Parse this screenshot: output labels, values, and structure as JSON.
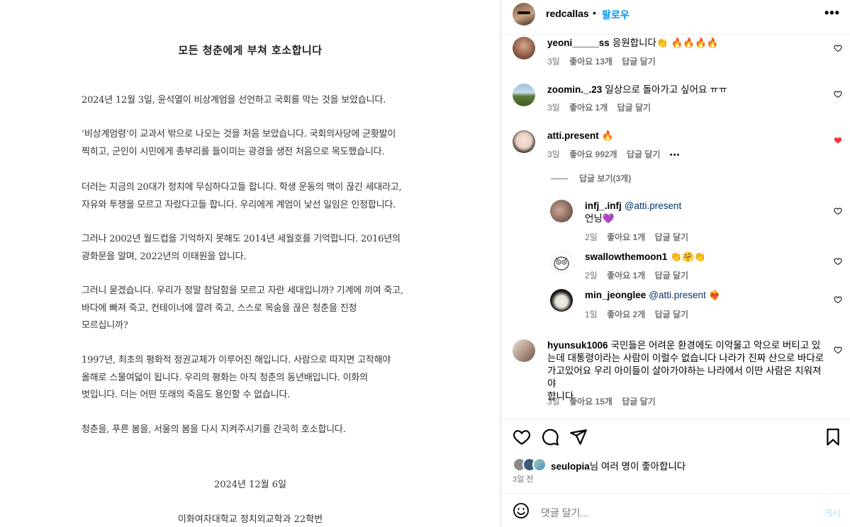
{
  "document": {
    "title": "모든 청춘에게 부쳐 호소합니다",
    "paragraphs": [
      [
        "2024년 12월 3일, 윤석열이 비상계엄을 선언하고 국회를 막는 것을 보았습니다."
      ],
      [
        "‘비상계엄령’이 교과서 밖으로 나오는 것을 처음 보았습니다. 국회의사당에 군홧발이",
        "찍히고, 군인이 시민에게 총부리를 들이미는 광경을 생전 처음으로 목도했습니다."
      ],
      [
        "더러는 지금의 20대가 정치에 무심하다고들 합니다. 학생 운동의 맥이 끊긴 세대라고,",
        "자유와 투쟁을 모르고 자랐다고들 합니다. 우리에게 계엄이 낯선 일임은 인정합니다."
      ],
      [
        "그러나 2002년 월드컵을 기억하지 못해도 2014년 세월호를 기억합니다. 2016년의",
        "광화문을 알며, 2022년의 이태원을 압니다."
      ],
      [
        "그러니 묻겠습니다. 우리가 정말 참담함을 모르고 자란 세대입니까? 기계에 끼여 죽고,",
        "바다에 빠져 죽고, 컨테이너에 깔려 죽고, 스스로 목숨을 끊은 청춘을 진정",
        "모르십니까?"
      ],
      [
        "1997년, 최초의 평화적 정권교체가 이루어진 해입니다. 사람으로 따지면 고작해야",
        "올해로 스물여덟이 됩니다. 우리의 평화는 아직 청춘의 동년배입니다. 이화의",
        "벗입니다. 더는 어떤 또래의 죽음도 용인할 수 없습니다."
      ],
      [
        "청춘을, 푸른 봄을, 서울의 봄을 다시 지켜주시기를 간곡히 호소합니다."
      ]
    ],
    "date": "2024년 12월 6일",
    "signature": "이화여자대학교 정치외교학과 22학번"
  },
  "header": {
    "username": "redcallas",
    "dot": "•",
    "follow": "팔로우",
    "more": "•••"
  },
  "comments": [
    {
      "username": "yeoni_____ss",
      "text": "응원합니다👏 🔥🔥🔥🔥",
      "age": "3일",
      "likes": "좋아요 13개",
      "reply": "답글 달기",
      "liked": false
    },
    {
      "username": "zoomin._.23",
      "text": "일상으로 돌아가고 싶어요 ㅠㅠ",
      "age": "3일",
      "likes": "좋아요 1개",
      "reply": "답글 달기",
      "liked": false
    },
    {
      "username": "atti.present",
      "text": "🔥",
      "age": "3일",
      "likes": "좋아요 992개",
      "reply": "답글 달기",
      "more": "•••",
      "liked": true
    }
  ],
  "view_replies": "답글 보기(3개)",
  "replies": [
    {
      "username": "infj_.infj",
      "mention": "@atti.present",
      "text": "언닝💜",
      "age": "2일",
      "likes": "좋아요 1개",
      "reply": "답글 달기"
    },
    {
      "username": "swallowthemoon1",
      "text": "👏🤗👏",
      "age": "2일",
      "likes": "좋아요 1개",
      "reply": "답글 달기"
    },
    {
      "username": "min_jeonglee",
      "mention": "@atti.present",
      "text": "❤️‍🔥",
      "age": "1일",
      "likes": "좋아요 2개",
      "reply": "답글 달기"
    }
  ],
  "long_comment": {
    "username": "hyunsuk1006",
    "lines": [
      "국민들은 어려운 환경에도 이악물고 악으로 버티고 있",
      "는데 대통령이라는 사람이 이럴수 없습니다 나라가 진짜 산으로 바다로",
      "가고있어요 우리 아이들이 살아가야하는 나라에서 이딴 사람은 치워져야",
      "합니다"
    ],
    "age": "3일",
    "likes": "좋아요 15개",
    "reply": "답글 달기"
  },
  "likes": {
    "user": "seulopia",
    "suffix": "님 여러 명이 좋아합니다"
  },
  "post_time": "3일 전",
  "composer": {
    "placeholder": "댓글 달기...",
    "post": "게시"
  },
  "colors": {
    "accent": "#0095f6",
    "liked": "#ff3040",
    "muted": "#737373"
  }
}
